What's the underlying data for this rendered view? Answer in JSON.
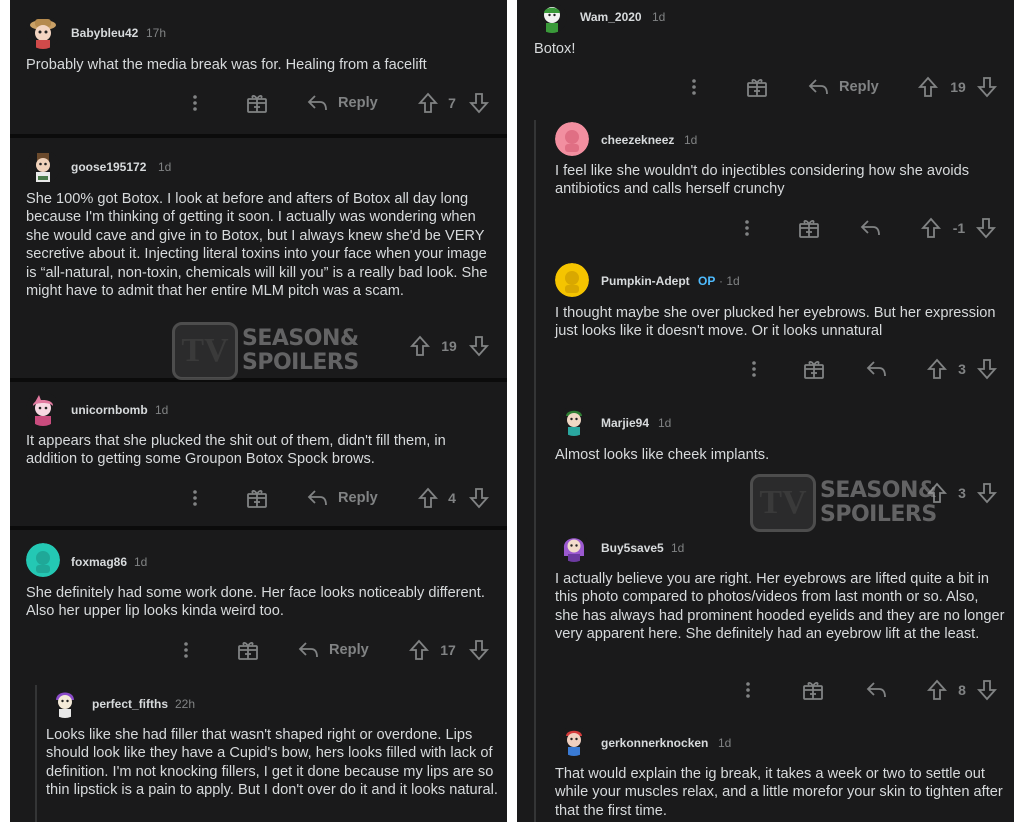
{
  "actions": {
    "reply": "Reply",
    "more": "more-options-icon"
  },
  "watermark": {
    "box": "TV",
    "line1": "SEASON&",
    "line2": "SPOILERS"
  },
  "left": {
    "comments": [
      {
        "user": "Babybleu42",
        "age": "17h",
        "body": "Probably what the media break was for.  Healing from a facelift",
        "score": "7",
        "reply": true
      },
      {
        "user": "goose195172",
        "age": "1d",
        "body": "She 100% got Botox. I look at before and afters of Botox all day long because I'm thinking of getting it soon. I actually was wondering when she would cave and give in to Botox, but I always knew she'd be VERY secretive about it. Injecting literal toxins into your face when your image is “all-natural, non-toxin, chemicals will kill you” is a really bad look. She might have to admit that her entire MLM pitch was a scam.",
        "score": "19",
        "reply": false
      },
      {
        "user": "unicornbomb",
        "age": "1d",
        "body": "It appears that she plucked the shit out of them, didn't fill them, in addition to getting some Groupon Botox Spock brows.",
        "score": "4",
        "reply": true
      },
      {
        "user": "foxmag86",
        "age": "1d",
        "body": "She definitely had some work done.  Her face looks noticeably different.  Also her upper lip looks kinda weird too.",
        "score": "17",
        "reply": true
      },
      {
        "user": "perfect_fifths",
        "age": "22h",
        "body": "Looks like she had filler that wasn't shaped right or overdone. Lips should look like they have a Cupid's bow, hers looks filled with lack of definition. I'm not knocking fillers, I get it done because my lips are so thin lipstick is a pain to apply. But I don't over do it and it looks natural."
      }
    ]
  },
  "right": {
    "comments": [
      {
        "user": "Wam_2020",
        "age": "1d",
        "body": "Botox!",
        "score": "19",
        "reply": true
      },
      {
        "user": "cheezekneez",
        "age": "1d",
        "body": "I feel like she wouldn't do injectibles considering how she avoids antibiotics and calls herself crunchy",
        "score": "-1",
        "reply": false
      },
      {
        "user": "Pumpkin-Adept",
        "op": "OP",
        "age": "· 1d",
        "body": "I thought maybe she over plucked her eyebrows.  But her expression just looks like it doesn't move. Or it looks unnatural",
        "score": "3",
        "reply": false
      },
      {
        "user": "Marjie94",
        "age": "1d",
        "body": "Almost looks like cheek implants.",
        "score": "3"
      },
      {
        "user": "Buy5save5",
        "age": "1d",
        "body": "I actually believe you are right. Her eyebrows are lifted quite a bit in this photo compared to photos/videos from last month or so. Also, she has always had prominent hooded eyelids and they are no longer very apparent here. She definitely had an eyebrow lift at the least.",
        "score": "8",
        "reply": false
      },
      {
        "user": "gerkonnerknocken",
        "age": "1d",
        "body": "That would explain the ig break, it takes a week or two to settle out while your muscles relax, and a little morefor your skin to tighten after that the first time."
      }
    ]
  }
}
